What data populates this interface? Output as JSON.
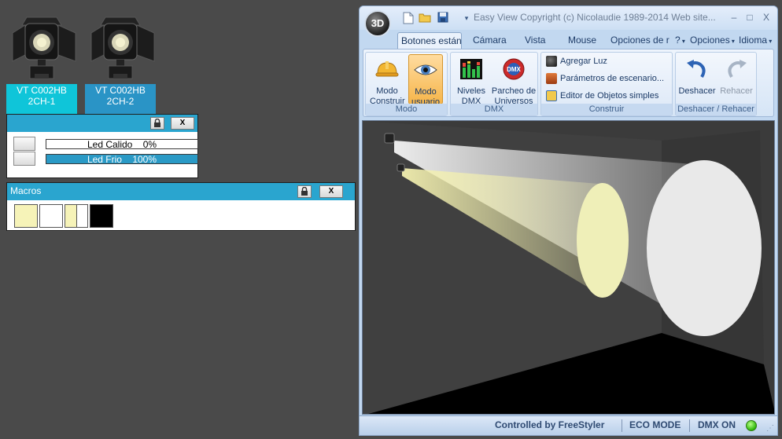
{
  "desktop": {
    "fixtures": [
      {
        "line1": "VT C002HB",
        "line2": "2CH-1",
        "color": "#0fc5d9"
      },
      {
        "line1": "VT C002HB",
        "line2": "2CH-2",
        "color": "#2a94c6"
      }
    ]
  },
  "channel_panel": {
    "lock_icon": "lock-icon",
    "close_label": "X",
    "channels": [
      {
        "name": "Led Calido",
        "value_text": "0%",
        "level": 0
      },
      {
        "name": "Led Frio",
        "value_text": "100%",
        "level": 1
      }
    ]
  },
  "macros_panel": {
    "title": "Macros",
    "close_label": "X",
    "swatches": [
      "#f6f3b8",
      "#ffffff",
      "split-#f6f3b8-#ffffff",
      "#000000"
    ]
  },
  "window": {
    "orb_label": "3D",
    "title": "Easy View   Copyright (c) Nicolaudie 1989-2014   Web site...",
    "controls": {
      "minimize": "–",
      "maximize": "□",
      "close": "X"
    },
    "tabs": [
      "Botones están",
      "Cámara",
      "Vista",
      "Mouse",
      "Opciones de r",
      "?",
      "Opciones",
      "Idioma"
    ],
    "active_tab": "Botones están",
    "ribbon": {
      "modo": {
        "caption": "Modo",
        "buttons": [
          {
            "line1": "Modo",
            "line2": "Construir"
          },
          {
            "line1": "Modo",
            "line2": "usuario"
          }
        ]
      },
      "dmx": {
        "caption": "DMX",
        "buttons": [
          {
            "line1": "Niveles",
            "line2": "DMX"
          },
          {
            "line1": "Parcheo de",
            "line2": "Universos"
          }
        ]
      },
      "construir": {
        "caption": "Construir",
        "items": [
          "Agregar Luz",
          "Parámetros de escenario...",
          "Editor de Objetos simples"
        ]
      },
      "undo": {
        "caption": "Deshacer / Rehacer",
        "buttons": [
          {
            "label": "Deshacer"
          },
          {
            "label": "Rehacer"
          }
        ]
      }
    },
    "status": {
      "controlled": "Controlled by FreeStyler",
      "eco": "ECO MODE",
      "dmx": "DMX ON"
    }
  }
}
